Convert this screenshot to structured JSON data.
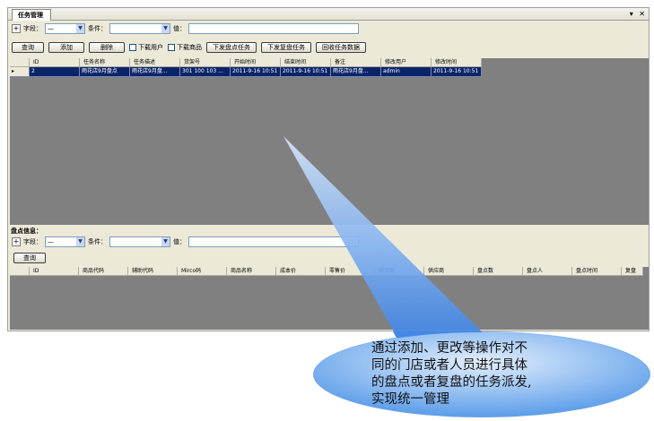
{
  "tab": {
    "title": "任务管理",
    "controls": "▾ ✕"
  },
  "filter": {
    "plus": "+",
    "field_label": "字段：",
    "field_value": "—",
    "condition_label": "条件：",
    "condition_value": "",
    "value_label": "值："
  },
  "toolbar": {
    "query": "查询",
    "add": "添加",
    "delete": "删除",
    "download_users": "下载用户",
    "download_goods": "下载商品",
    "issue_count_task": "下发盘点任务",
    "issue_recount_task": "下发复盘任务",
    "recycle_task_data": "回收任务数据"
  },
  "task_table": {
    "columns": [
      "ID",
      "任务名称",
      "任务描述",
      "货架号",
      "开始时间",
      "结束时间",
      "备注",
      "修改用户",
      "修改时间"
    ],
    "rows": [
      {
        "indicator": "▸",
        "cells": [
          "2",
          "雨花店9月盘点",
          "雨花店9月盘...",
          "301 100 103 ...",
          "2011-9-16 10:51",
          "2011-9-16 10:51",
          "雨花店9月盘...",
          "admin",
          "2011-9-16 10:51"
        ]
      }
    ]
  },
  "detail": {
    "section_label": "盘点信息：",
    "plus": "+",
    "field_label": "字段：",
    "field_value": "—",
    "condition_label": "条件：",
    "condition_value": "",
    "value_label": "值：",
    "query": "查询",
    "columns": [
      "ID",
      "商品代码",
      "辅助代码",
      "Mirco码",
      "商品名称",
      "成本价",
      "零售价",
      "供货商",
      "供应商",
      "盘点数",
      "盘点人",
      "盘点时间",
      "复盘"
    ]
  },
  "callout": {
    "lines": [
      "通过添加、更改等操作对不",
      "同的门店或者人员进行具体",
      "的盘点或者复盘的任务派发,",
      "实现统一管理"
    ],
    "fill": "#7fb2ec",
    "ray_fill": "#4f8fe6"
  }
}
